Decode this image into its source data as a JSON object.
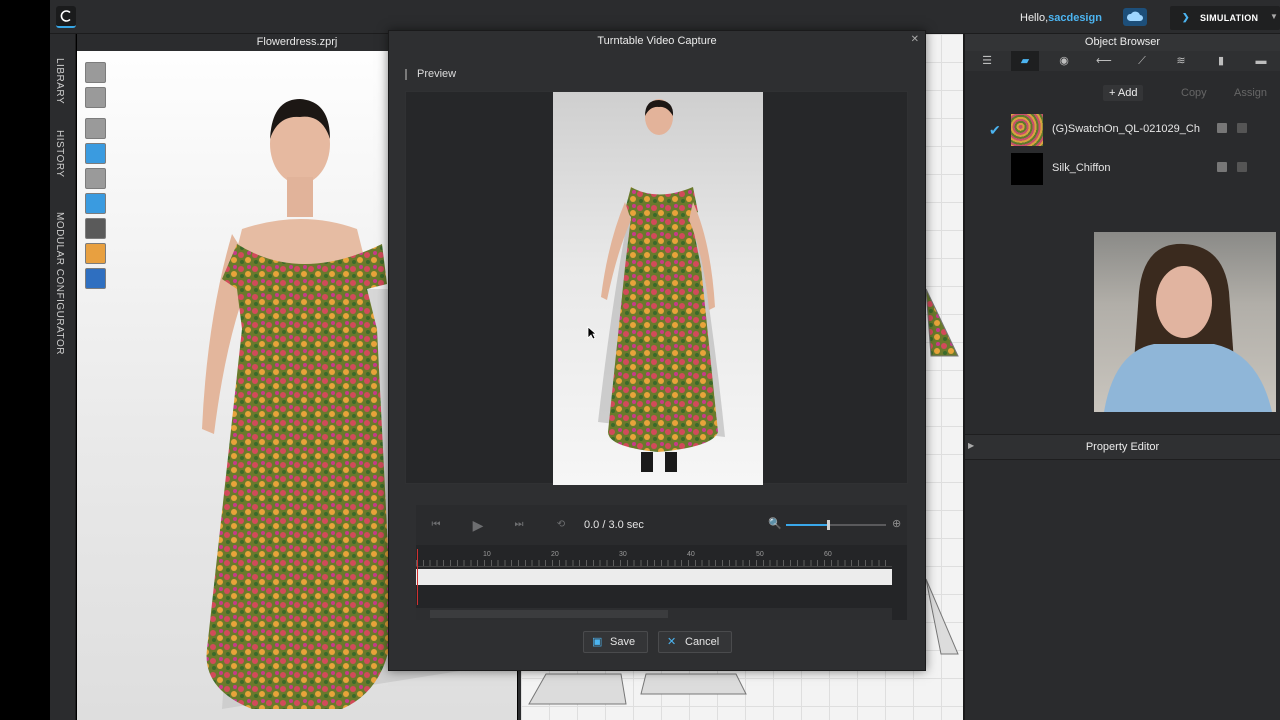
{
  "app": {
    "greeting": "Hello,",
    "username": "sacdesign",
    "mode_label": "SIMULATION"
  },
  "side_tabs": {
    "library": "LIBRARY",
    "history": "HISTORY",
    "modular": "MODULAR CONFIGURATOR"
  },
  "viewport3d": {
    "file_title": "Flowerdress.zprj"
  },
  "object_browser": {
    "title": "Object Browser",
    "add_label": "Add",
    "copy_label": "Copy",
    "assign_label": "Assign",
    "fabrics": [
      {
        "name": "(G)SwatchOn_QL-021029_Ch",
        "selected": true,
        "swatch": "floral"
      },
      {
        "name": "Silk_Chiffon",
        "selected": false,
        "swatch": "black"
      }
    ]
  },
  "property_editor": {
    "title": "Property Editor"
  },
  "dialog": {
    "title": "Turntable Video Capture",
    "preview_label": "Preview",
    "time_display": "0.0 / 3.0 sec",
    "ruler_ticks": [
      "10",
      "20",
      "30",
      "40",
      "50",
      "60"
    ],
    "zoom_level": 0.6,
    "save_label": "Save",
    "cancel_label": "Cancel"
  },
  "colors": {
    "accent": "#3aa8ea",
    "panel": "#2e2f31",
    "playhead": "#d03030"
  }
}
